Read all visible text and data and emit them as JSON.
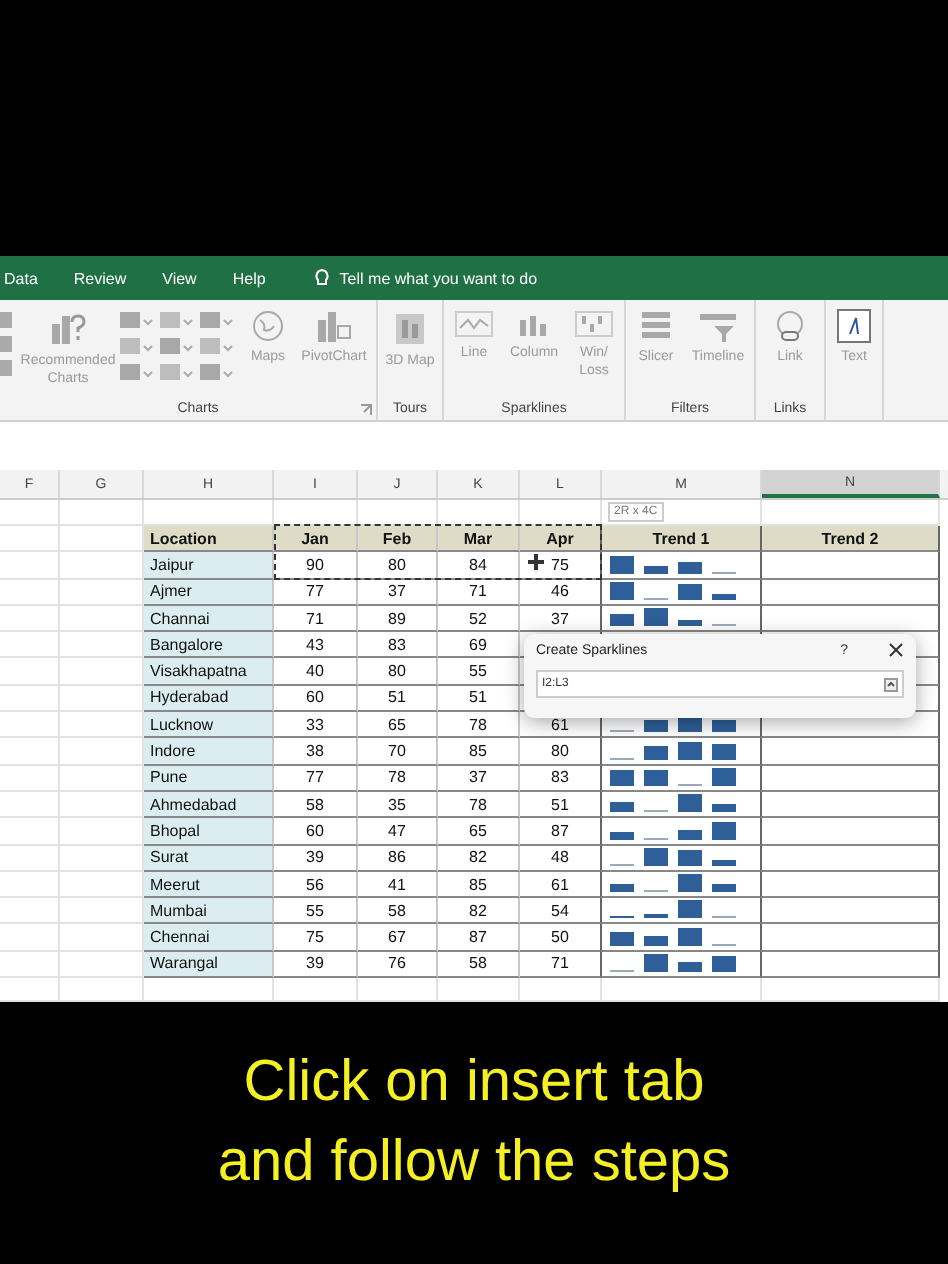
{
  "ribbon": {
    "tabs": [
      {
        "label": "Data"
      },
      {
        "label": "Review"
      },
      {
        "label": "View"
      },
      {
        "label": "Help"
      }
    ],
    "tell_me": "Tell me what you want to do",
    "groups": [
      {
        "label": "Charts",
        "launcher": true,
        "buttons": [
          {
            "label": "Recommended Charts",
            "kind": "recommended"
          },
          {
            "kind": "gallery"
          },
          {
            "label": "Maps",
            "kind": "maps"
          },
          {
            "label": "PivotChart",
            "kind": "pivot"
          }
        ]
      },
      {
        "label": "Tours",
        "buttons": [
          {
            "label": "3D Map",
            "kind": "map3d"
          }
        ]
      },
      {
        "label": "Sparklines",
        "buttons": [
          {
            "label": "Line",
            "kind": "line"
          },
          {
            "label": "Column",
            "kind": "column"
          },
          {
            "label": "Win/ Loss",
            "kind": "winloss"
          }
        ]
      },
      {
        "label": "Filters",
        "buttons": [
          {
            "label": "Slicer",
            "kind": "slicer"
          },
          {
            "label": "Timeline",
            "kind": "timeline"
          }
        ]
      },
      {
        "label": "Links",
        "buttons": [
          {
            "label": "Link",
            "kind": "link"
          }
        ]
      },
      {
        "buttons": [
          {
            "label": "Text",
            "kind": "text"
          }
        ]
      }
    ]
  },
  "sheet": {
    "columns": [
      {
        "label": "F",
        "selected": false
      },
      {
        "label": "G",
        "selected": false
      },
      {
        "label": "H",
        "selected": false
      },
      {
        "label": "I",
        "selected": false
      },
      {
        "label": "J",
        "selected": false
      },
      {
        "label": "K",
        "selected": false
      },
      {
        "label": "L",
        "selected": false
      },
      {
        "label": "M",
        "selected": false
      },
      {
        "label": "N",
        "selected": true
      }
    ],
    "size_tip": "2R x 4C",
    "headers": [
      "Location",
      "Jan",
      "Feb",
      "Mar",
      "Apr",
      "Trend 1",
      "Trend 2"
    ],
    "rows": [
      {
        "location": "Jaipur",
        "values": [
          "90",
          "80",
          "84",
          "75"
        ]
      },
      {
        "location": "Ajmer",
        "values": [
          "77",
          "37",
          "71",
          "46"
        ]
      },
      {
        "location": "Channai",
        "values": [
          "71",
          "89",
          "52",
          "37"
        ]
      },
      {
        "location": "Bangalore",
        "values": [
          "43",
          "83",
          "69"
        ]
      },
      {
        "location": "Visakhapatna",
        "values": [
          "40",
          "80",
          "55"
        ]
      },
      {
        "location": "Hyderabad",
        "values": [
          "60",
          "51",
          "51"
        ]
      },
      {
        "location": "Lucknow",
        "values": [
          "33",
          "65",
          "78",
          "61"
        ]
      },
      {
        "location": "Indore",
        "values": [
          "38",
          "70",
          "85",
          "80"
        ]
      },
      {
        "location": "Pune",
        "values": [
          "77",
          "78",
          "37",
          "83"
        ]
      },
      {
        "location": "Ahmedabad",
        "values": [
          "58",
          "35",
          "78",
          "51"
        ]
      },
      {
        "location": "Bhopal",
        "values": [
          "60",
          "47",
          "65",
          "87"
        ]
      },
      {
        "location": "Surat",
        "values": [
          "39",
          "86",
          "82",
          "48"
        ]
      },
      {
        "location": "Meerut",
        "values": [
          "56",
          "41",
          "85",
          "61"
        ]
      },
      {
        "location": "Mumbai",
        "values": [
          "55",
          "58",
          "82",
          "54"
        ]
      },
      {
        "location": "Chennai",
        "values": [
          "75",
          "67",
          "87",
          "50"
        ]
      },
      {
        "location": "Warangal",
        "values": [
          "39",
          "76",
          "58",
          "71"
        ]
      }
    ]
  },
  "dialog": {
    "title": "Create Sparklines",
    "help": "?",
    "range": "I2:L3"
  },
  "caption": [
    "Click on insert tab",
    "and follow the steps"
  ]
}
